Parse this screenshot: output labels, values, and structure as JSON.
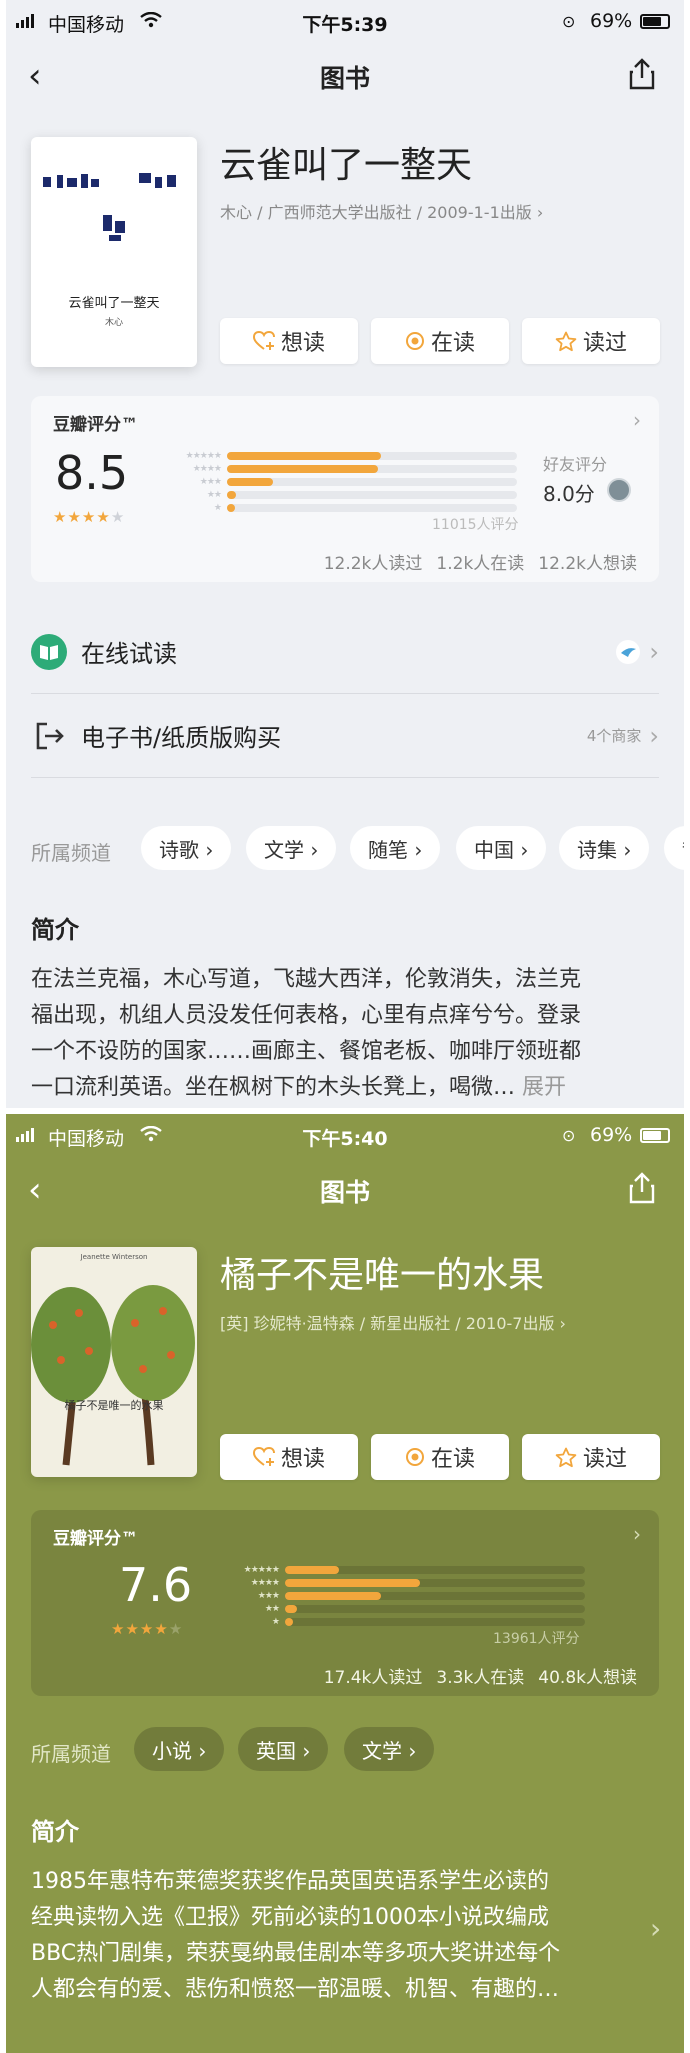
{
  "screens": [
    {
      "status": {
        "carrier": "中国移动",
        "time": "下午5:39",
        "battery": "69%"
      },
      "nav_title": "图书",
      "book": {
        "title": "云雀叫了一整天",
        "meta": "木心 / 广西师范大学出版社 / 2009-1-1出版 ›",
        "cover_title": "云雀叫了一整天",
        "cover_author": "木心"
      },
      "actions": {
        "want": "想读",
        "reading": "在读",
        "read": "读过"
      },
      "rating": {
        "label": "豆瓣评分™",
        "score": "8.5",
        "stars_filled": 4,
        "distribution": [
          0.53,
          0.52,
          0.16,
          0.03,
          0.02
        ],
        "count": "11015人评分",
        "friend_label": "好友评分",
        "friend_score": "8.0分",
        "stats": [
          "12.2k人读过",
          "1.2k人在读",
          "12.2k人想读"
        ]
      },
      "rows": {
        "online": "在线试读",
        "buy": "电子书/纸质版购买",
        "buy_right": "4个商家"
      },
      "channels": {
        "label": "所属频道",
        "items": [
          "诗歌 ›",
          "文学 ›",
          "随笔 ›",
          "中国 ›",
          "诗集 ›",
          "散"
        ]
      },
      "intro": {
        "heading": "简介",
        "lines": [
          "在法兰克福，木心写道，飞越大西洋，伦敦消失，法兰克",
          "福出现，机组人员没发任何表格，心里有点痒兮兮。登录",
          "一个不设防的国家……画廊主、餐馆老板、咖啡厅领班都",
          "一口流利英语。坐在枫树下的木头长凳上，喝微…"
        ],
        "expand": "展开"
      }
    },
    {
      "status": {
        "carrier": "中国移动",
        "time": "下午5:40",
        "battery": "69%"
      },
      "nav_title": "图书",
      "book": {
        "title": "橘子不是唯一的水果",
        "meta": "[英] 珍妮特·温特森 / 新星出版社 / 2010-7出版 ›",
        "cover_title": "橘子不是唯一的水果",
        "cover_author": "Jeanette Winterson"
      },
      "actions": {
        "want": "想读",
        "reading": "在读",
        "read": "读过"
      },
      "rating": {
        "label": "豆瓣评分™",
        "score": "7.6",
        "stars_filled": 4,
        "distribution": [
          0.18,
          0.45,
          0.32,
          0.04,
          0.02
        ],
        "count": "13961人评分",
        "stats": [
          "17.4k人读过",
          "3.3k人在读",
          "40.8k人想读"
        ]
      },
      "channels": {
        "label": "所属频道",
        "items": [
          "小说 ›",
          "英国 ›",
          "文学 ›"
        ]
      },
      "intro": {
        "heading": "简介",
        "lines": [
          "1985年惠特布莱德奖获奖作品英国英语系学生必读的",
          "经典读物入选《卫报》死前必读的1000本小说改编成",
          "BBC热门剧集，荣获戛纳最佳剧本等多项大奖讲述每个",
          "人都会有的爱、悲伤和愤怒一部温暖、机智、有趣的…"
        ]
      }
    }
  ],
  "colors": {
    "bar": "#f2a63c",
    "star": "#f2a63c",
    "green_bg": "#8b9848",
    "gray_bg": "#eef0f4",
    "online_icon": "#2dab78"
  }
}
